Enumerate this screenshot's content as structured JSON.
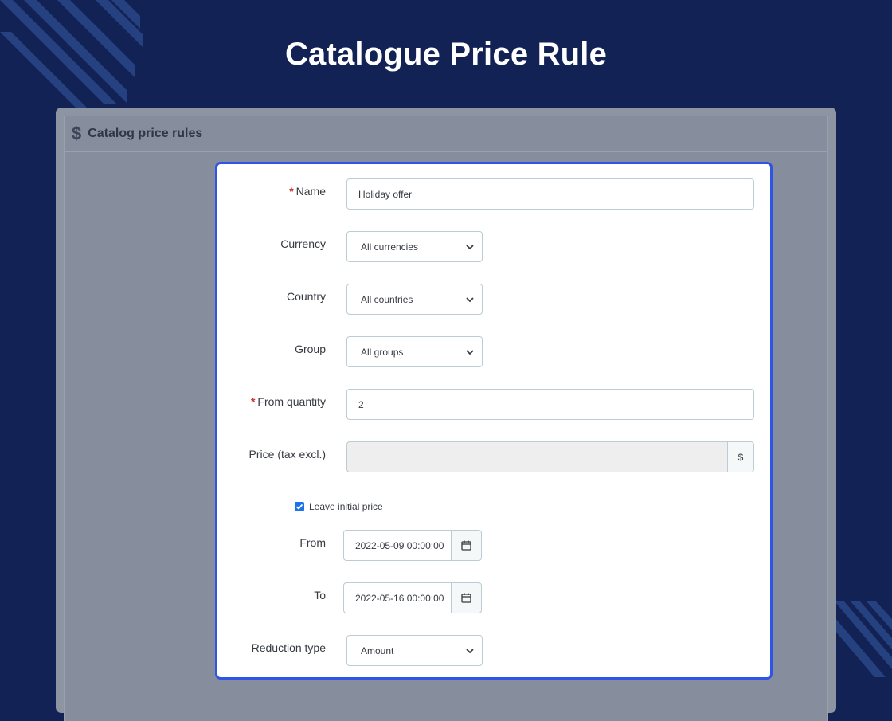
{
  "page": {
    "title": "Catalogue Price Rule"
  },
  "panel": {
    "icon": "dollar-icon",
    "icon_glyph": "$",
    "title": "Catalog price rules"
  },
  "form": {
    "name": {
      "label": "Name",
      "required_mark": "*",
      "value": "Holiday offer"
    },
    "currency": {
      "label": "Currency",
      "selected": "All currencies"
    },
    "country": {
      "label": "Country",
      "selected": "All countries"
    },
    "group": {
      "label": "Group",
      "selected": "All groups"
    },
    "from_quantity": {
      "label": "From quantity",
      "required_mark": "*",
      "value": "2"
    },
    "price": {
      "label": "Price (tax excl.)",
      "value": "",
      "currency_symbol": "$"
    },
    "leave_initial_price": {
      "label": "Leave initial price",
      "checked": true
    },
    "from": {
      "label": "From",
      "value": "2022-05-09 00:00:00"
    },
    "to": {
      "label": "To",
      "value": "2022-05-16 00:00:00"
    },
    "reduction_type": {
      "label": "Reduction type",
      "selected": "Amount"
    }
  },
  "colors": {
    "background": "#122254",
    "card_border": "#2f55e6",
    "required": "#d0312d",
    "checkbox": "#1a73e8"
  }
}
